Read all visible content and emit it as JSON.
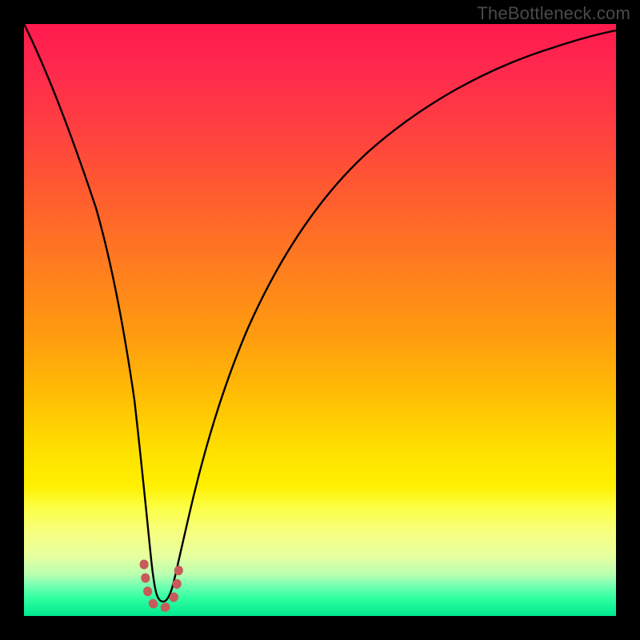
{
  "watermark": "TheBottleneck.com",
  "colors": {
    "curve": "#000000",
    "highlight": "#c85a5a",
    "background_black": "#000000"
  },
  "chart_data": {
    "type": "line",
    "title": "",
    "xlabel": "",
    "ylabel": "",
    "xlim": [
      0,
      100
    ],
    "ylim": [
      0,
      100
    ],
    "note": "V-shaped bottleneck curve; minimum near x≈22, y≈4. Background hue encodes bottleneck severity (red=high, green=low). Axis ticks not shown.",
    "series": [
      {
        "name": "bottleneck-curve",
        "x": [
          0,
          2,
          4,
          6,
          8,
          10,
          12,
          14,
          16,
          18,
          19,
          20,
          21,
          22,
          23,
          24,
          25,
          27,
          30,
          34,
          38,
          42,
          48,
          55,
          62,
          70,
          78,
          86,
          94,
          100
        ],
        "y": [
          100,
          92,
          84,
          76,
          68,
          60,
          52,
          44,
          35,
          24,
          18,
          12,
          7,
          4,
          4,
          7,
          12,
          21,
          33,
          46,
          55,
          62,
          70,
          77,
          82,
          86,
          89,
          92,
          94,
          96
        ]
      },
      {
        "name": "min-highlight",
        "x": [
          19.5,
          20.5,
          21.5,
          22.5,
          23.5,
          24.5
        ],
        "y": [
          10,
          6,
          4,
          4,
          6,
          10
        ]
      }
    ]
  }
}
